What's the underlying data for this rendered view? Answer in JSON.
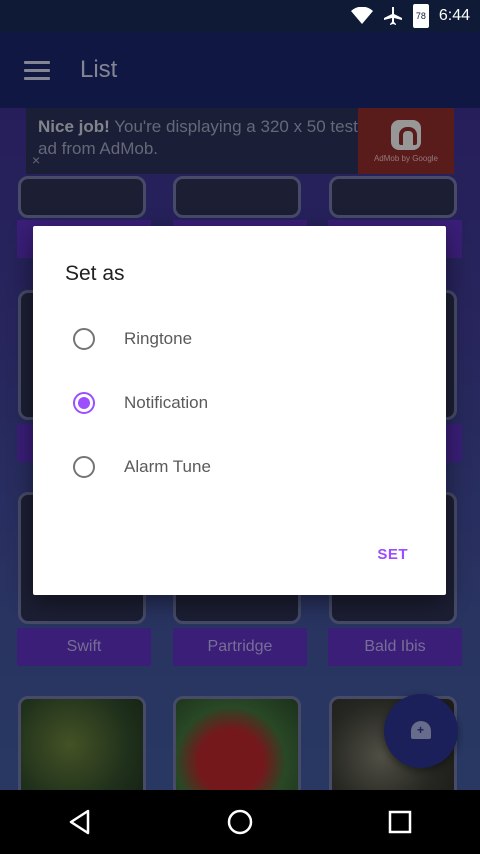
{
  "status_bar": {
    "time": "6:44",
    "battery": "78"
  },
  "app_bar": {
    "title": "List"
  },
  "ad": {
    "bold": "Nice job!",
    "text": " You're displaying a 320 x 50 test ad from AdMob.",
    "close": "×",
    "logo_caption": "AdMob by Google"
  },
  "grid": {
    "labels": [
      "Swift",
      "Partridge",
      "Bald Ibis"
    ]
  },
  "dialog": {
    "title": "Set as",
    "options": [
      {
        "label": "Ringtone",
        "checked": false
      },
      {
        "label": "Notification",
        "checked": true
      },
      {
        "label": "Alarm Tune",
        "checked": false
      }
    ],
    "action": "SET"
  },
  "colors": {
    "accent": "#9c4dff",
    "app_bar": "#1a2466",
    "label": "#5a2fb8"
  },
  "icons": {
    "fab": "add-notification-icon",
    "nav": [
      "back-icon",
      "home-icon",
      "recents-icon"
    ]
  }
}
